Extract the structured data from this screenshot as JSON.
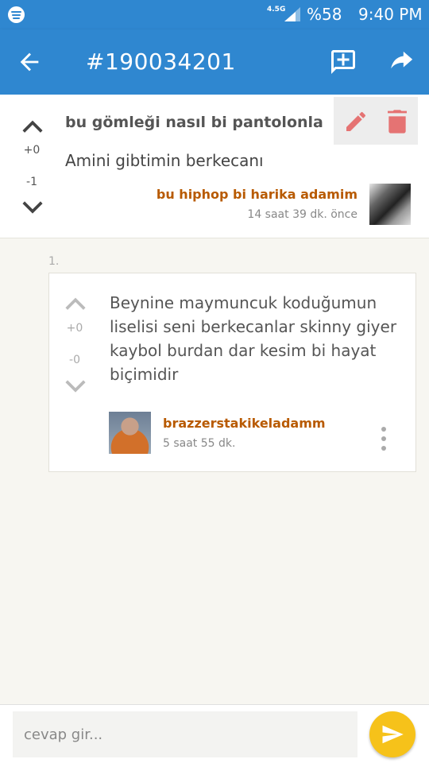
{
  "status_bar": {
    "network": "4.5G",
    "battery": "%58",
    "time": "9:40 PM",
    "icons": [
      "spotify-icon",
      "signal-icon"
    ]
  },
  "app_bar": {
    "title": "#190034201",
    "icons": [
      "back-arrow-icon",
      "add-comment-icon",
      "share-icon"
    ]
  },
  "post": {
    "title": "bu gömleği nasıl bi pantolonla",
    "body": "Amini gibtimin berkecanı",
    "upvotes": "+0",
    "downvotes": "-1",
    "author": "bu hiphop bi harika adamim",
    "time": "14 saat 39 dk. önce",
    "icons": [
      "pencil-icon",
      "trash-icon"
    ],
    "colors": {
      "author": "#b85a00",
      "action": "#e57373"
    }
  },
  "reply": {
    "number": "1.",
    "text": "Beynine maymuncuk koduğumun liselisi seni berkecanlar skinny giyer kaybol burdan dar kesim bi hayat biçimidir",
    "upvotes": "+0",
    "downvotes": "-0",
    "author": "brazzerstakikeladamm",
    "time": "5 saat 55 dk."
  },
  "input": {
    "placeholder": "cevap gir..."
  },
  "colors": {
    "primary": "#2f87d0",
    "send_button": "#f6c21a",
    "background": "#f7f6f1"
  }
}
